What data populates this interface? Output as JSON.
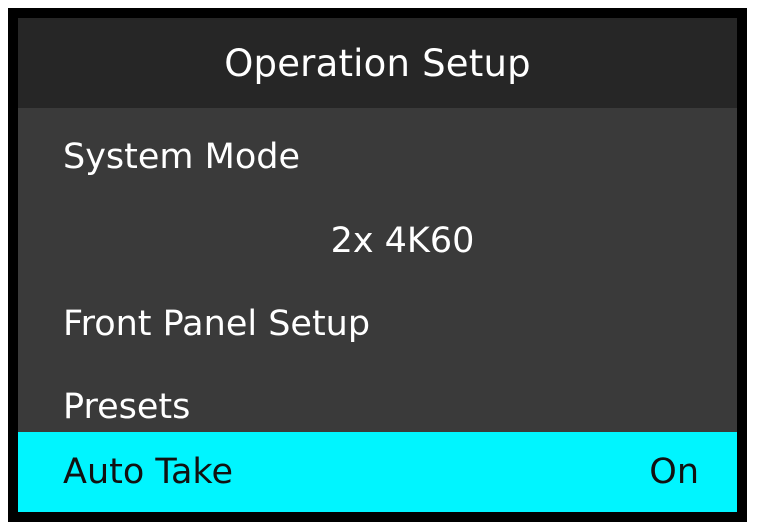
{
  "screen": {
    "title": "Operation Setup",
    "items": [
      {
        "label": "System Mode"
      },
      {
        "value": "2x 4K60"
      },
      {
        "label": "Front Panel Setup"
      },
      {
        "label": "Presets"
      },
      {
        "label": "Auto Take",
        "value": "On"
      }
    ]
  },
  "colors": {
    "frame": "#000000",
    "background": "#3a3a3a",
    "title_bar": "#262626",
    "highlight": "#00f5ff",
    "text": "#ffffff",
    "highlight_text": "#111111"
  }
}
